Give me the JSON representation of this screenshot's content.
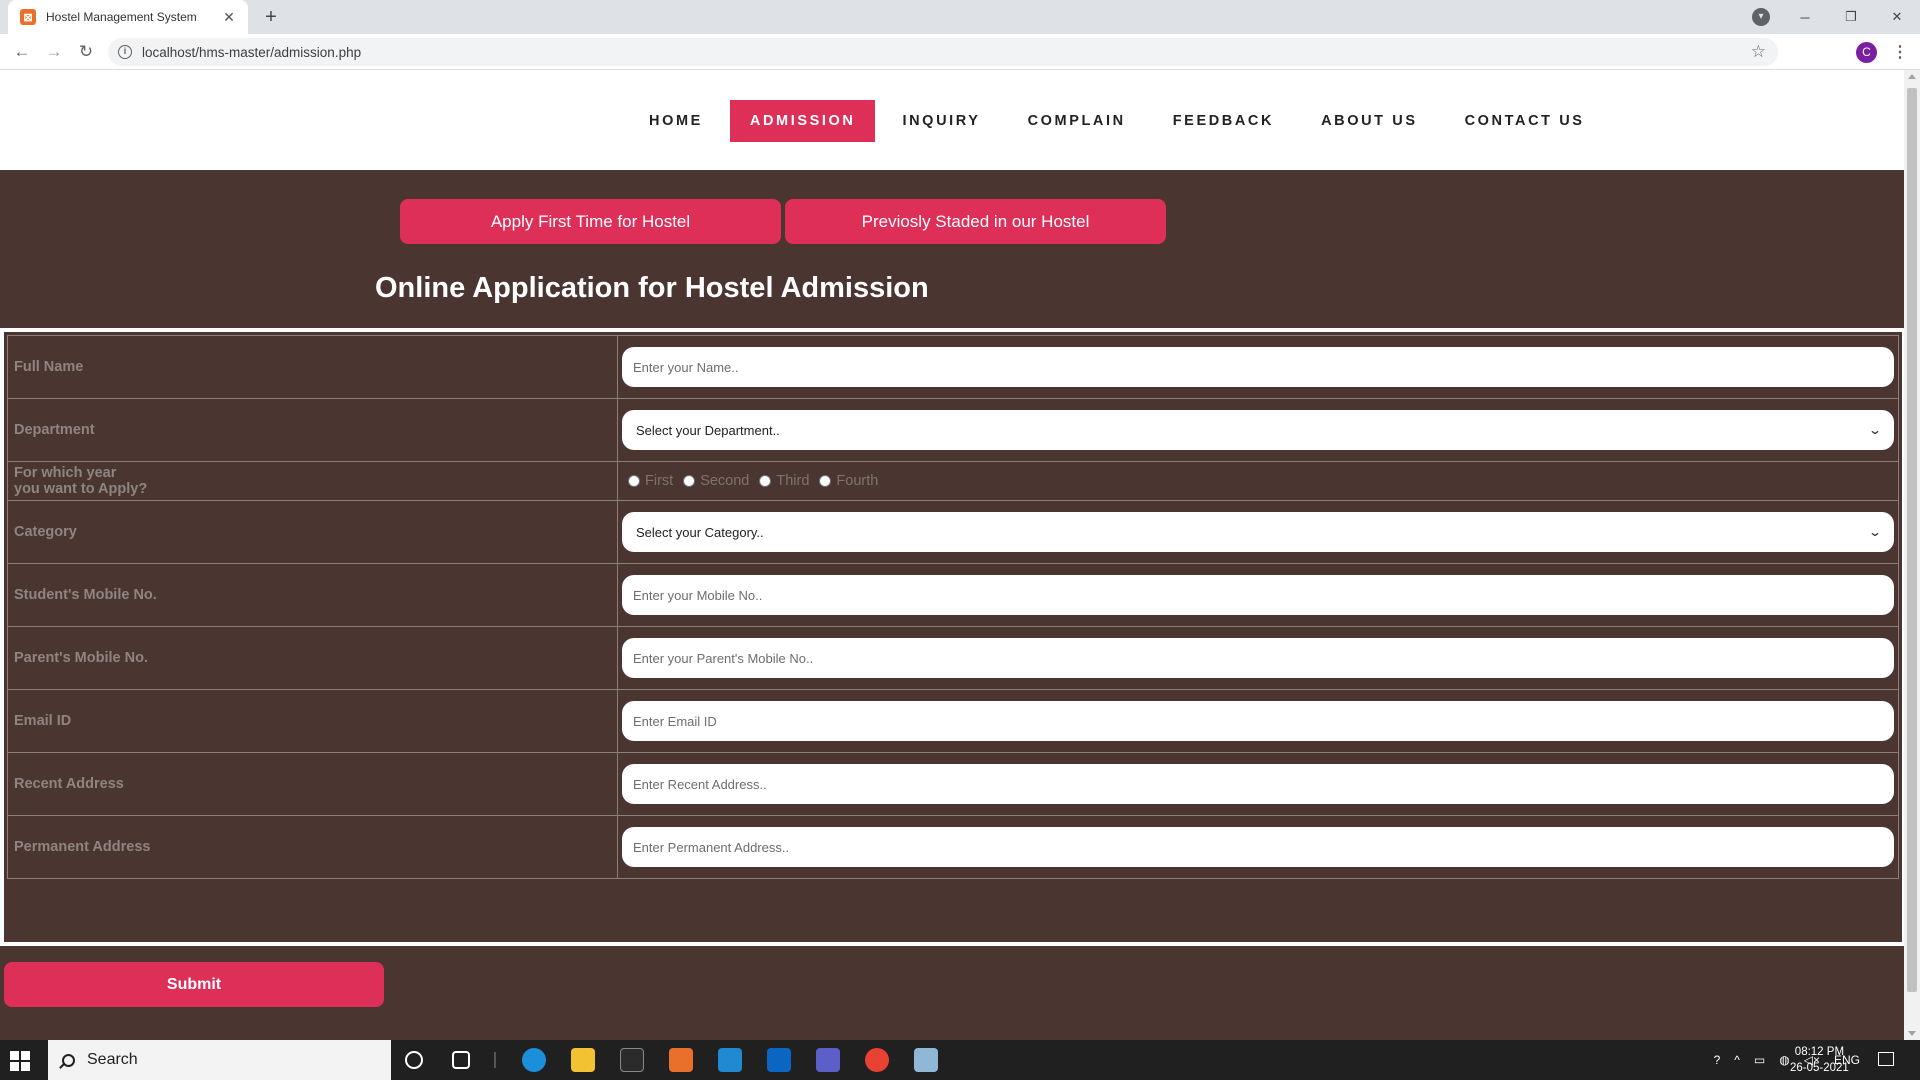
{
  "browser": {
    "tab_title": "Hostel Management System",
    "tab_favicon": "xampp-icon",
    "tab_close": "✕",
    "new_tab": "+",
    "url": "localhost/hms-master/admission.php",
    "profile_initial": "C"
  },
  "site_nav": {
    "items": [
      {
        "label": "HOME",
        "active": false
      },
      {
        "label": "ADMISSION",
        "active": true
      },
      {
        "label": "INQUIRY",
        "active": false
      },
      {
        "label": "COMPLAIN",
        "active": false
      },
      {
        "label": "FEEDBACK",
        "active": false
      },
      {
        "label": "ABOUT US",
        "active": false
      },
      {
        "label": "CONTACT US",
        "active": false
      }
    ]
  },
  "toggles": {
    "first_time": "Apply First Time for Hostel",
    "previously": "Previosly Staded in our Hostel"
  },
  "form": {
    "heading": "Online Application for Hostel Admission",
    "full_name": {
      "label": "Full Name",
      "placeholder": "Enter your Name.."
    },
    "department": {
      "label": "Department",
      "selected": "Select your Department.."
    },
    "year": {
      "label_line1": "For which year",
      "label_line2": "you want to Apply?",
      "options": [
        "First",
        "Second",
        "Third",
        "Fourth"
      ]
    },
    "category": {
      "label": "Category",
      "selected": "Select your Category.."
    },
    "student_mobile": {
      "label": "Student's Mobile No.",
      "placeholder": "Enter your Mobile No.."
    },
    "parent_mobile": {
      "label": "Parent's Mobile No.",
      "placeholder": "Enter your Parent's Mobile No.."
    },
    "email": {
      "label": "Email ID",
      "placeholder": "Enter Email ID"
    },
    "recent_address": {
      "label": "Recent Address",
      "placeholder": "Enter Recent Address.."
    },
    "permanent_address": {
      "label": "Permanent Address",
      "placeholder": "Enter Permanent Address.."
    },
    "submit": "Submit"
  },
  "taskbar": {
    "search_text": "Search",
    "language": "ENG",
    "time": "08:12 PM",
    "date": "26-05-2021"
  },
  "colors": {
    "accent": "#de2f58",
    "page_bg": "#4a3531",
    "header_bg": "#ffffff"
  }
}
